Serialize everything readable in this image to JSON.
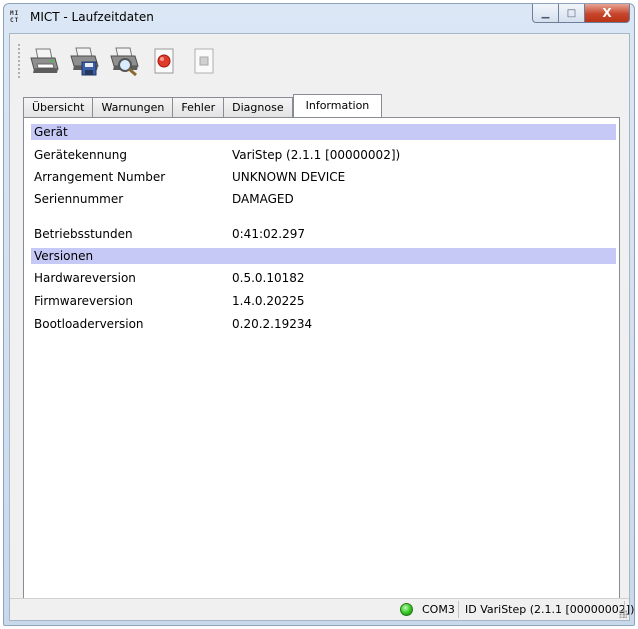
{
  "window": {
    "title": "MICT - Laufzeitdaten",
    "app_icon_text": "MI CT",
    "min_label": "▁",
    "max_label": "□",
    "close_label": "X"
  },
  "toolbar": {
    "buttons": [
      "print-icon",
      "save-icon",
      "print-preview-icon",
      "record-icon",
      "stop-icon"
    ]
  },
  "tabs": [
    {
      "label": "Übersicht"
    },
    {
      "label": "Warnungen"
    },
    {
      "label": "Fehler"
    },
    {
      "label": "Diagnose"
    },
    {
      "label": "Information",
      "active": true
    }
  ],
  "info": {
    "section_device": "Gerät",
    "device_id_label": "Gerätekennung",
    "device_id_value": "VariStep (2.1.1 [00000002])",
    "arrangement_label": "Arrangement Number",
    "arrangement_value": "UNKNOWN DEVICE",
    "serial_label": "Seriennummer",
    "serial_value": "DAMAGED",
    "hours_label": "Betriebsstunden",
    "hours_value": "0:41:02.297",
    "section_versions": "Versionen",
    "hw_label": "Hardwareversion",
    "hw_value": "0.5.0.10182",
    "fw_label": "Firmwareversion",
    "fw_value": "1.4.0.20225",
    "bl_label": "Bootloaderversion",
    "bl_value": "0.20.2.19234"
  },
  "status": {
    "port": "COM3",
    "device": "ID VariStep (2.1.1 [00000002])",
    "connection_color": "#2fc21d"
  },
  "colors": {
    "section_bar": "#c6c9f5",
    "close_button": "#c7452b"
  }
}
